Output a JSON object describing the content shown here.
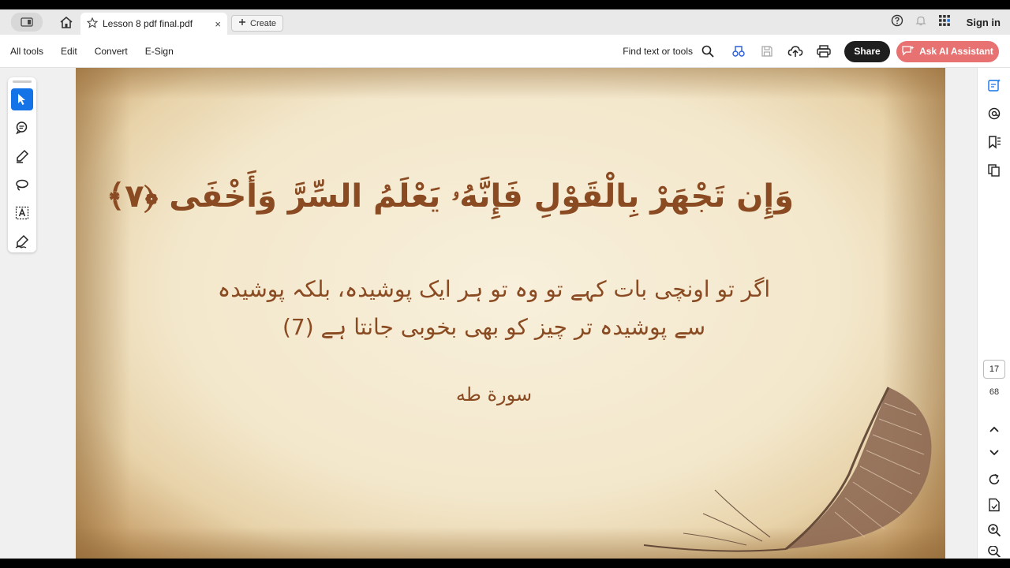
{
  "tabbar": {
    "tab_title": "Lesson 8 pdf final.pdf",
    "close_symbol": "×",
    "create_label": "Create",
    "signin_label": "Sign in",
    "icons": [
      "panel-toggle-icon",
      "home-icon",
      "star-icon",
      "help-icon",
      "bell-icon",
      "apps-grid-icon"
    ]
  },
  "menubar": {
    "items": [
      "All tools",
      "Edit",
      "Convert",
      "E-Sign"
    ],
    "find_label": "Find text or tools",
    "share_label": "Share",
    "ai_label": "Ask AI Assistant",
    "icons": [
      "search-icon",
      "compare-icon",
      "save-icon",
      "upload-cloud-icon",
      "print-icon",
      "ai-sparkle-icon"
    ]
  },
  "left_tools": [
    "select-cursor-icon",
    "comment-icon",
    "highlight-pen-icon",
    "lasso-draw-icon",
    "text-select-icon",
    "sign-pen-icon"
  ],
  "document": {
    "arabic_verse": "وَإِن تَجْهَرْ بِالْقَوْلِ فَإِنَّهُۥ يَعْلَمُ السِّرَّ وَأَخْفَى ﴿٧﴾",
    "urdu_line_1": "اگر تو اونچی بات کہے تو وہ تو ہر ایک پوشیدہ، بلکہ پوشیدہ",
    "urdu_line_2": "سے پوشیدہ تر چیز کو بھی بخوبی جانتا ہے (7)",
    "surah_name": "سورة طه"
  },
  "right_panel": {
    "current_page": "17",
    "total_pages": "68",
    "icons": [
      "ai-summary-icon",
      "comments-panel-icon",
      "bookmark-icon",
      "pages-icon",
      "chevron-up-icon",
      "chevron-down-icon",
      "rotate-icon",
      "page-extract-icon",
      "zoom-in-icon",
      "zoom-out-icon"
    ]
  },
  "colors": {
    "accent_blue": "#1473e6",
    "ai_button": "#e87272",
    "text_brown": "#8a4a22"
  }
}
